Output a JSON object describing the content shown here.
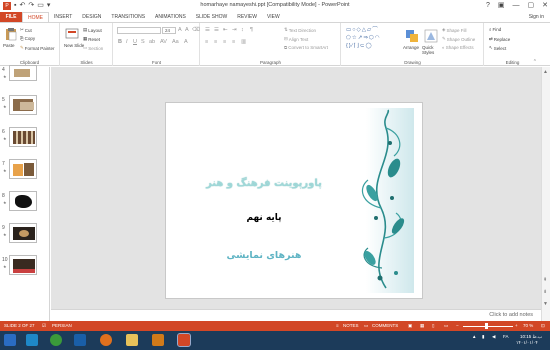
{
  "window": {
    "title": "homarhaye namayeshi.ppt [Compatibility Mode] - PowerPoint",
    "controls": [
      "?",
      "▣",
      "—",
      "▢",
      "✕"
    ]
  },
  "tabs": {
    "file": "FILE",
    "items": [
      "HOME",
      "INSERT",
      "DESIGN",
      "TRANSITIONS",
      "ANIMATIONS",
      "SLIDE SHOW",
      "REVIEW",
      "VIEW"
    ],
    "signin": "Sign in"
  },
  "ribbon": {
    "clipboard": {
      "label": "Clipboard",
      "paste": "Paste",
      "cut": "Cut",
      "copy": "Copy",
      "format_painter": "Format Painter"
    },
    "slides": {
      "label": "Slides",
      "new_slide": "New Slide",
      "layout": "Layout",
      "reset": "Reset",
      "section": "Section"
    },
    "font": {
      "label": "Font",
      "font_name": "",
      "font_size": "24"
    },
    "paragraph": {
      "label": "Paragraph",
      "text_direction": "Text Direction",
      "align_text": "Align Text",
      "convert_smartart": "Convert to SmartArt"
    },
    "drawing": {
      "label": "Drawing",
      "arrange": "Arrange",
      "quick_styles": "Quick Styles",
      "shape_fill": "Shape Fill",
      "shape_outline": "Shape Outline",
      "shape_effects": "Shape Effects"
    },
    "editing": {
      "label": "Editing",
      "find": "Find",
      "replace": "Replace",
      "select": "Select"
    }
  },
  "thumbnails": [
    {
      "num": "4"
    },
    {
      "num": "5"
    },
    {
      "num": "6"
    },
    {
      "num": "7"
    },
    {
      "num": "8"
    },
    {
      "num": "9"
    },
    {
      "num": "10"
    }
  ],
  "slide": {
    "title": "پاورپوینت فرهنگ و هنر",
    "subtitle": "پایه نهم",
    "line3": "هنرهای نمایشی"
  },
  "notes": {
    "placeholder": "Click to add notes"
  },
  "status": {
    "slide_info": "SLIDE 2 OF 27",
    "language": "PERSIAN",
    "notes_btn": "NOTES",
    "comments_btn": "COMMENTS",
    "zoom": "70 %"
  },
  "taskbar": {
    "lang": "FA",
    "time": "10:15 ب.ظ",
    "date": "۱۴۰۱/۰۱/۰۴"
  },
  "colors": {
    "accent": "#d24726",
    "taskbar": "#1c3b5a",
    "ornament": "#2a8c8c"
  }
}
